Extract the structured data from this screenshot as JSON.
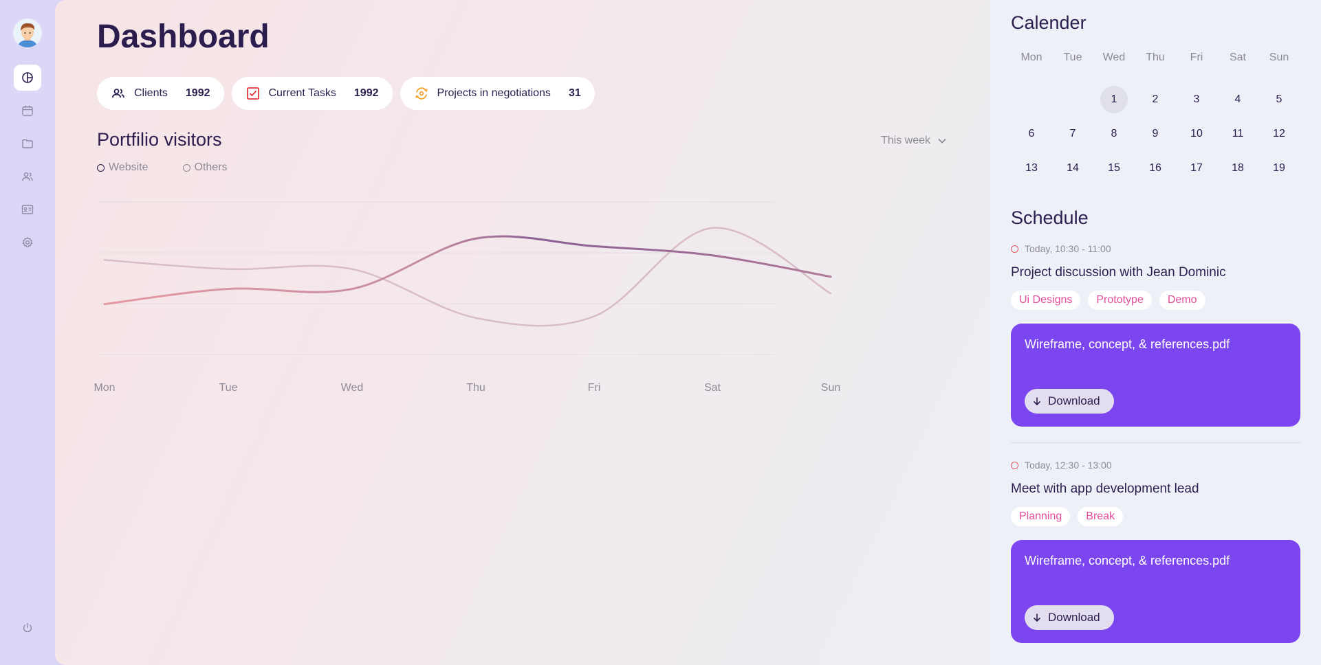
{
  "page": {
    "title": "Dashboard"
  },
  "sidebar": {
    "items": [
      {
        "icon": "pie-chart-icon",
        "active": true
      },
      {
        "icon": "calendar-icon",
        "active": false
      },
      {
        "icon": "folder-icon",
        "active": false
      },
      {
        "icon": "users-icon",
        "active": false
      },
      {
        "icon": "id-card-icon",
        "active": false
      },
      {
        "icon": "gear-icon",
        "active": false
      }
    ],
    "bottom_icon": "power-icon"
  },
  "stats": [
    {
      "icon": "users-icon",
      "label": "Clients",
      "value": "1992"
    },
    {
      "icon": "checkbox-icon",
      "label": "Current Tasks",
      "value": "1992"
    },
    {
      "icon": "sync-icon",
      "label": "Projects in negotiations",
      "value": "31"
    }
  ],
  "visitors": {
    "title": "Portfilio visitors",
    "period": "This week",
    "legend": [
      "Website",
      "Others"
    ]
  },
  "chart_data": {
    "type": "line",
    "categories": [
      "Mon",
      "Tue",
      "Wed",
      "Thu",
      "Fri",
      "Sat",
      "Sun"
    ],
    "series": [
      {
        "name": "Website",
        "color": "#8a5f93",
        "values": [
          0.33,
          0.43,
          0.43,
          0.76,
          0.71,
          0.65,
          0.51
        ]
      },
      {
        "name": "Others",
        "color": "#d8bcc8",
        "values": [
          0.62,
          0.56,
          0.56,
          0.24,
          0.25,
          0.83,
          0.4
        ]
      }
    ],
    "grid": true,
    "legend_position": "top-left"
  },
  "calendar": {
    "title": "Calender",
    "weekdays": [
      "Mon",
      "Tue",
      "Wed",
      "Thu",
      "Fri",
      "Sat",
      "Sun"
    ],
    "days": [
      "",
      "",
      "1",
      "2",
      "3",
      "4",
      "5",
      "6",
      "7",
      "8",
      "9",
      "10",
      "11",
      "12",
      "13",
      "14",
      "15",
      "16",
      "17",
      "18",
      "19"
    ],
    "selected": "1"
  },
  "schedule": {
    "title": "Schedule",
    "events": [
      {
        "time": "Today, 10:30 - 11:00",
        "title": "Project discussion with Jean Dominic",
        "tags": [
          "Ui Designs",
          "Prototype",
          "Demo"
        ],
        "file": "Wireframe, concept, & references.pdf",
        "button": "Download"
      },
      {
        "time": "Today, 12:30 - 13:00",
        "title": "Meet with app development lead",
        "tags": [
          "Planning",
          "Break"
        ],
        "file": "Wireframe, concept, & references.pdf",
        "button": "Download"
      }
    ]
  },
  "colors": {
    "accent": "#7b45ef",
    "tag_text": "#e34c9a",
    "heading": "#2b1d4e",
    "event_dot": "#e05b65"
  }
}
